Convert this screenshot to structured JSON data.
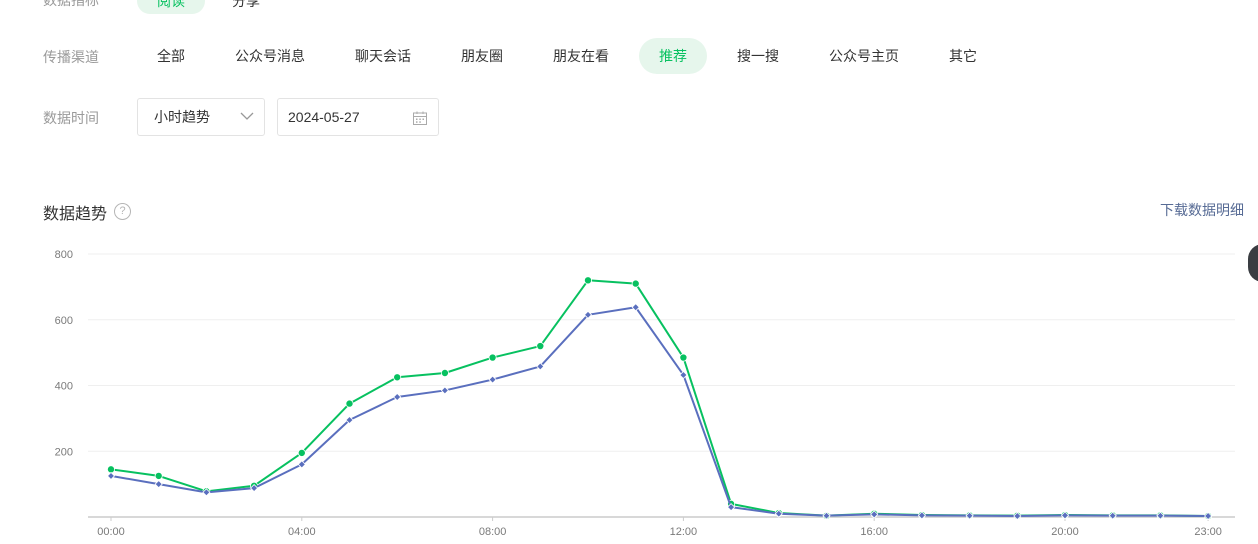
{
  "filters": {
    "top_row": {
      "label_partial": "数据指标",
      "active_value": "阅读",
      "other_value": "分享"
    },
    "channel": {
      "label": "传播渠道",
      "options": [
        "全部",
        "公众号消息",
        "聊天会话",
        "朋友圈",
        "朋友在看",
        "推荐",
        "搜一搜",
        "公众号主页",
        "其它"
      ],
      "active": "推荐"
    },
    "time": {
      "label": "数据时间",
      "granularity": "小时趋势",
      "date": "2024-05-27"
    }
  },
  "section": {
    "title": "数据趋势",
    "help": "?",
    "download": "下载数据明细"
  },
  "colors": {
    "series_green": "#07c160",
    "series_blue": "#5a6fbe",
    "grid": "#efefef",
    "axis": "#cccccc"
  },
  "chart_data": {
    "type": "line",
    "x": [
      "00:00",
      "01:00",
      "02:00",
      "03:00",
      "04:00",
      "05:00",
      "06:00",
      "07:00",
      "08:00",
      "09:00",
      "10:00",
      "11:00",
      "12:00",
      "13:00",
      "14:00",
      "15:00",
      "16:00",
      "17:00",
      "18:00",
      "19:00",
      "20:00",
      "21:00",
      "22:00",
      "23:00"
    ],
    "x_tick_labels": [
      "00:00",
      "04:00",
      "08:00",
      "12:00",
      "16:00",
      "20:00",
      "23:00"
    ],
    "y_tick_labels": [
      "200",
      "400",
      "600",
      "800"
    ],
    "ylim": [
      0,
      800
    ],
    "grid": true,
    "series": [
      {
        "color": "#07c160",
        "marker": "circle",
        "values": [
          145,
          125,
          78,
          95,
          195,
          345,
          425,
          438,
          485,
          520,
          720,
          710,
          485,
          40,
          12,
          4,
          10,
          6,
          5,
          4,
          6,
          5,
          5,
          3
        ]
      },
      {
        "color": "#5a6fbe",
        "marker": "diamond",
        "values": [
          125,
          100,
          75,
          88,
          160,
          295,
          365,
          385,
          418,
          458,
          615,
          638,
          432,
          30,
          10,
          4,
          8,
          5,
          4,
          3,
          5,
          4,
          4,
          3
        ]
      }
    ]
  }
}
